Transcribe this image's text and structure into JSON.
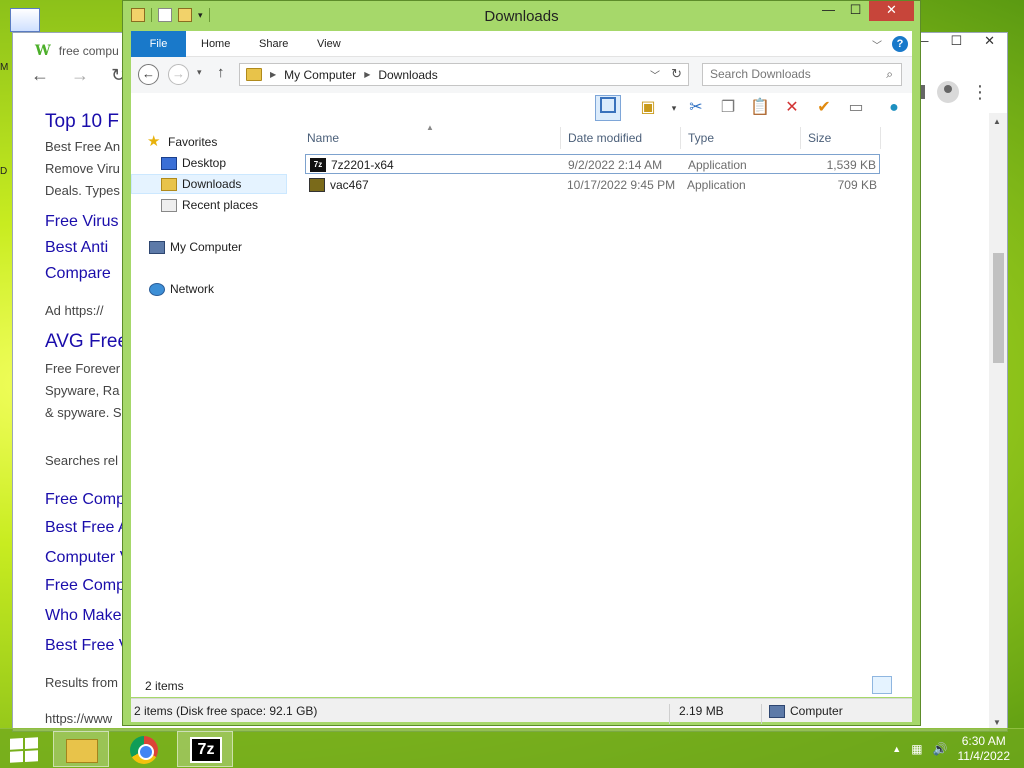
{
  "browser": {
    "tab_title": "free compu",
    "tab_icon": "W",
    "lines": [
      {
        "text": "Top 10 F",
        "cls": "c-blue",
        "size": 19
      },
      {
        "text": "Best Free An",
        "cls": "c-gray",
        "size": 13
      },
      {
        "text": "Remove Viru",
        "cls": "c-gray",
        "size": 13
      },
      {
        "text": "Deals. Types",
        "cls": "c-gray",
        "size": 13
      },
      {
        "text": "Free Virus",
        "cls": "c-blue",
        "size": 16
      },
      {
        "text": "Best Anti",
        "cls": "c-blue",
        "size": 16
      },
      {
        "text": "Compare",
        "cls": "c-blue",
        "size": 16
      },
      {
        "text": "Ad  https://",
        "cls": "c-gray",
        "size": 13
      },
      {
        "text": "AVG Free",
        "cls": "c-blue",
        "size": 19
      },
      {
        "text": "Free Forever",
        "cls": "c-gray",
        "size": 13
      },
      {
        "text": "Spyware, Ra",
        "cls": "c-gray",
        "size": 13
      },
      {
        "text": "& spyware. S",
        "cls": "c-gray",
        "size": 13
      },
      {
        "text": "Searches rel",
        "cls": "c-gray",
        "size": 13
      },
      {
        "text": "Free Comp",
        "cls": "c-blue",
        "size": 16
      },
      {
        "text": "Best Free A",
        "cls": "c-blue",
        "size": 16
      },
      {
        "text": "Computer V",
        "cls": "c-blue",
        "size": 16
      },
      {
        "text": "Free Comp",
        "cls": "c-blue",
        "size": 16
      },
      {
        "text": "Who Make",
        "cls": "c-blue",
        "size": 16
      },
      {
        "text": "Best Free V",
        "cls": "c-blue",
        "size": 16
      },
      {
        "text": "Results from",
        "cls": "c-gray",
        "size": 13
      },
      {
        "text": "https://www",
        "cls": "c-gray",
        "size": 13
      }
    ]
  },
  "explorer": {
    "title": "Downloads",
    "ribbon_tabs": {
      "file": "File",
      "home": "Home",
      "share": "Share",
      "view": "View"
    },
    "breadcrumb": {
      "root": "My Computer",
      "current": "Downloads"
    },
    "search_placeholder": "Search Downloads",
    "nav": {
      "favorites": "Favorites",
      "desktop": "Desktop",
      "downloads": "Downloads",
      "recent": "Recent places",
      "computer": "My Computer",
      "network": "Network"
    },
    "columns": {
      "name": "Name",
      "date": "Date modified",
      "type": "Type",
      "size": "Size"
    },
    "files": [
      {
        "name": "7z2201-x64",
        "date": "9/2/2022 2:14 AM",
        "type": "Application",
        "size": "1,539 KB",
        "icon": "7z-icon"
      },
      {
        "name": "vac467",
        "date": "10/17/2022 9:45 PM",
        "type": "Application",
        "size": "709 KB",
        "icon": "app-icon"
      }
    ],
    "item_count": "2 items",
    "statusbar": {
      "summary": "2 items (Disk free space: 92.1 GB)",
      "size": "2.19 MB",
      "location": "Computer"
    }
  },
  "taskbar": {
    "apps": [
      "file-explorer",
      "chrome",
      "7-zip"
    ],
    "seven_zip_label": "7z",
    "time": "6:30 AM",
    "date": "11/4/2022"
  }
}
